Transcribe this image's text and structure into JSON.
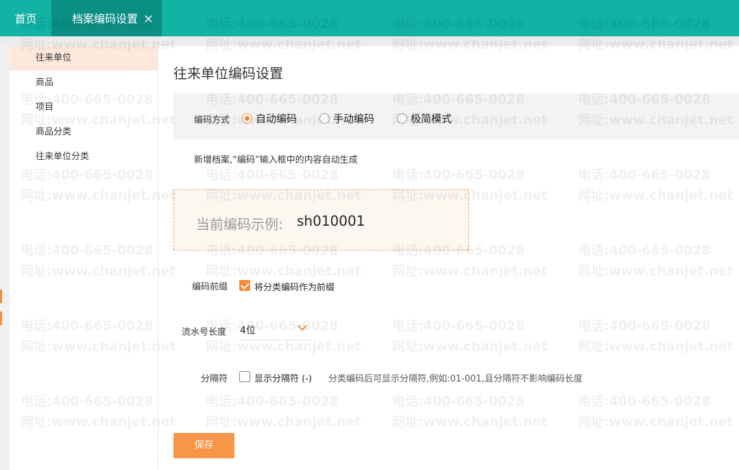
{
  "topbar": {
    "home_tab": "首页",
    "active_tab": "档案编码设置",
    "close_glyph": "×"
  },
  "sidebar": {
    "items": [
      {
        "label": "往来单位"
      },
      {
        "label": "商品"
      },
      {
        "label": "项目"
      },
      {
        "label": "商品分类"
      },
      {
        "label": "往来单位分类"
      }
    ]
  },
  "main": {
    "title": "往来单位编码设置",
    "mode": {
      "label": "编码方式",
      "options": [
        "自动编码",
        "手动编码",
        "极简模式"
      ],
      "selected": "自动编码"
    },
    "description": "新增档案,“编码”输入框中的内容自动生成",
    "example": {
      "label": "当前编码示例:",
      "value": "sh010001"
    },
    "prefix": {
      "label": "编码前缀",
      "checkbox_label": "将分类编码作为前缀",
      "checked": true
    },
    "serial": {
      "label": "流水号长度",
      "value": "4位"
    },
    "separator": {
      "label": "分隔符",
      "checkbox_label": "显示分隔符 (-)",
      "note": "分类编码后可显示分隔符,例如:01-001,且分隔符不影响编码长度",
      "checked": false
    },
    "save_label": "保存"
  },
  "watermark": {
    "line1": "电话:400-665-0028",
    "line2": "网址:www.chanjet.net"
  },
  "colors": {
    "topbar": "#12b2a5",
    "active_tab": "#0b8f85",
    "accent": "#f28c3c",
    "save_button": "#f79549",
    "sidebar_active": "#fde8dc"
  }
}
